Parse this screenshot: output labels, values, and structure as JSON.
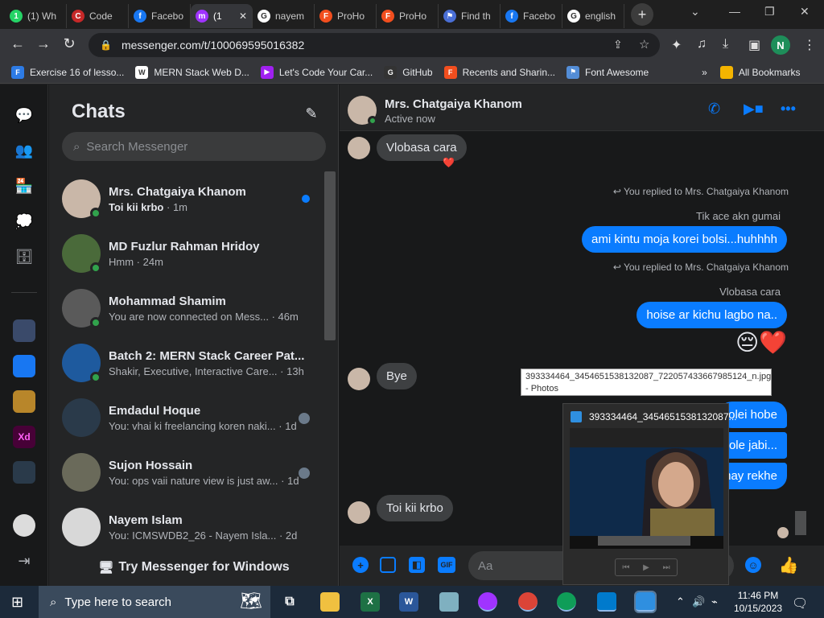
{
  "browser": {
    "tabs": [
      {
        "label": "(1) Wh",
        "favicon_color": "#25d366",
        "favicon_char": "1"
      },
      {
        "label": "Code",
        "favicon_color": "#c62828",
        "favicon_char": "C"
      },
      {
        "label": "Facebo",
        "favicon_color": "#1877f2",
        "favicon_char": "f"
      },
      {
        "label": "(1",
        "favicon_color": "#a033ff",
        "favicon_char": "m",
        "active": true
      },
      {
        "label": "nayem",
        "favicon_color": "#ffffff",
        "favicon_char": "G"
      },
      {
        "label": "ProHo",
        "favicon_color": "#f24e1e",
        "favicon_char": "F"
      },
      {
        "label": "ProHo",
        "favicon_color": "#f24e1e",
        "favicon_char": "F"
      },
      {
        "label": "Find th",
        "favicon_color": "#4a6fd6",
        "favicon_char": "⚑"
      },
      {
        "label": "Facebo",
        "favicon_color": "#1877f2",
        "favicon_char": "f"
      },
      {
        "label": "english",
        "favicon_color": "#ffffff",
        "favicon_char": "G"
      }
    ],
    "new_tab": "+",
    "url": "messenger.com/t/100069595016382",
    "profile_initial": "N",
    "bookmarks": [
      {
        "label": "Exercise 16 of lesso...",
        "color": "#2d7be5",
        "char": "F"
      },
      {
        "label": "MERN Stack Web D...",
        "color": "#ffffff",
        "char": "W"
      },
      {
        "label": "Let's Code Your Car...",
        "color": "#a020f0",
        "char": "▶"
      },
      {
        "label": "GitHub",
        "color": "#333333",
        "char": "G"
      },
      {
        "label": "Recents and Sharin...",
        "color": "#f24e1e",
        "char": "F"
      },
      {
        "label": "Font Awesome",
        "color": "#538dd7",
        "char": "⚑"
      }
    ],
    "all_bookmarks": "All Bookmarks",
    "more_bookmarks": "»"
  },
  "sidebar": {
    "title": "Chats",
    "search_placeholder": "Search Messenger",
    "try_windows": "Try Messenger for Windows",
    "conversations": [
      {
        "name": "Mrs. Chatgaiya Khanom",
        "preview": "Toi kii krbo",
        "time": "· 1m",
        "unread": true,
        "online": true,
        "avatar_color": "#c9b7a8"
      },
      {
        "name": "MD Fuzlur Rahman Hridoy",
        "preview": "Hmm",
        "time": "· 24m",
        "unread": false,
        "online": true,
        "avatar_color": "#4a6a3a"
      },
      {
        "name": "Mohammad Shamim",
        "preview": "You are now connected on Mess...",
        "time": "· 46m",
        "unread": false,
        "online": true,
        "avatar_color": "#5a5a5a"
      },
      {
        "name": "Batch 2: MERN Stack Career Pat...",
        "preview": "Shakir, Executive, Interactive Care...",
        "time": "· 13h",
        "unread": false,
        "online": true,
        "avatar_color": "#1e5a9e"
      },
      {
        "name": "Emdadul Hoque",
        "preview": "You: vhai ki freelancing koren naki...",
        "time": "· 1d",
        "unread": false,
        "online": false,
        "avatar_color": "#2a3a4a"
      },
      {
        "name": "Sujon Hossain",
        "preview": "You: ops vaii nature view is just aw...",
        "time": "· 1d",
        "unread": false,
        "online": false,
        "avatar_color": "#6a6a5a"
      },
      {
        "name": "Nayem Islam",
        "preview": "You: ICMSWDB2_26 - Nayem Isla...",
        "time": "· 2d",
        "unread": false,
        "online": false,
        "avatar_color": "#d8d8d8"
      }
    ]
  },
  "thread": {
    "contact_name": "Mrs. Chatgaiya Khanom",
    "status": "Active now",
    "messages": {
      "m1": "Vlobasa cara",
      "m1_reaction": "❤️",
      "reply1_label": "You replied to Mrs. Chatgaiya Khanom",
      "reply1_quote": "Tik ace akn gumai",
      "m2": "ami kintu moja korei bolsi...huhhhh",
      "reply2_label": "You replied to Mrs. Chatgaiya Khanom",
      "reply2_quote": "Vlobasa cara",
      "m3": "hoise ar kichu lagbo na..",
      "m4_emoji": "😔❤️",
      "m5": "Bye",
      "m6": "olei hobe",
      "m7": "hole jabi...",
      "m8": "may rekhe",
      "m9": "Toi kii krbo"
    },
    "composer_placeholder": "Aa"
  },
  "overlay": {
    "tooltip_line1": "393334464_3454651538132087_722057433667985124_n.jpg",
    "tooltip_line2": "- Photos",
    "preview_title": "393334464_3454651538132087..."
  },
  "taskbar": {
    "search_placeholder": "Type here to search",
    "time": "11:46 PM",
    "date": "10/15/2023"
  }
}
